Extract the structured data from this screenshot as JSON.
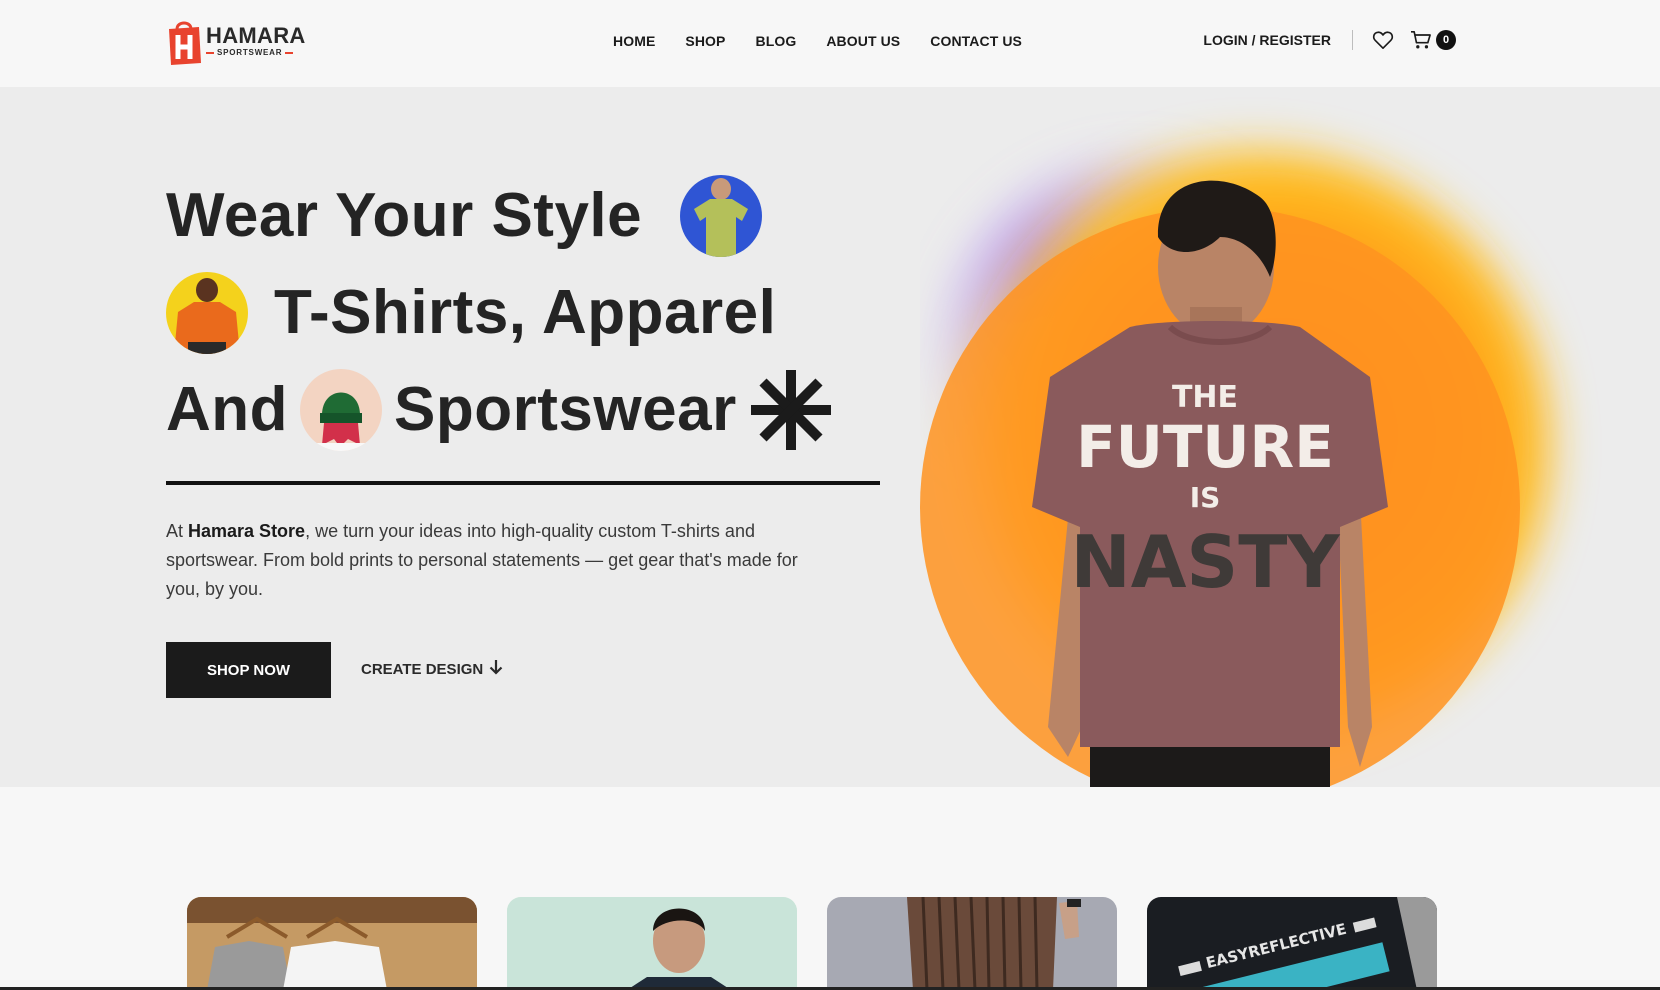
{
  "header": {
    "logo": {
      "brand": "HAMARA",
      "tagline": "SPORTSWEAR"
    },
    "nav": [
      {
        "label": "HOME"
      },
      {
        "label": "SHOP"
      },
      {
        "label": "BLOG"
      },
      {
        "label": "ABOUT US"
      },
      {
        "label": "CONTACT US"
      }
    ],
    "login_label": "LOGIN / REGISTER",
    "cart_count": "0",
    "icons": [
      "heart-icon",
      "cart-icon"
    ]
  },
  "hero": {
    "line1": "Wear Your Style",
    "line2": "T-Shirts, Apparel",
    "line3_a": "And",
    "line3_b": "Sportswear",
    "desc_prefix": "At ",
    "desc_brand": "Hamara Store",
    "desc_rest": ", we turn your ideas into high-quality custom T-shirts and sportswear. From bold prints to personal statements — get gear that's made for you, by you.",
    "shop_button": "SHOP NOW",
    "create_button": "CREATE DESIGN",
    "shirt_print": {
      "line1": "THE",
      "line2": "FUTURE",
      "line3": "IS",
      "line4": "NASTY"
    }
  },
  "cards": [
    {
      "name": "hangers-tshirts"
    },
    {
      "name": "model-portrait"
    },
    {
      "name": "striped-pants"
    },
    {
      "name": "reflective-label",
      "label": "EASYREFLECTIVE"
    }
  ],
  "colors": {
    "accent": "#e8432e",
    "dark": "#1b1b1b",
    "hero_bg": "#ececec",
    "gradient_orange": "#ff8a1f",
    "gradient_yellow": "#ffc21a",
    "gradient_purple": "#a77bf0",
    "shirt": "#8a5a5c"
  }
}
